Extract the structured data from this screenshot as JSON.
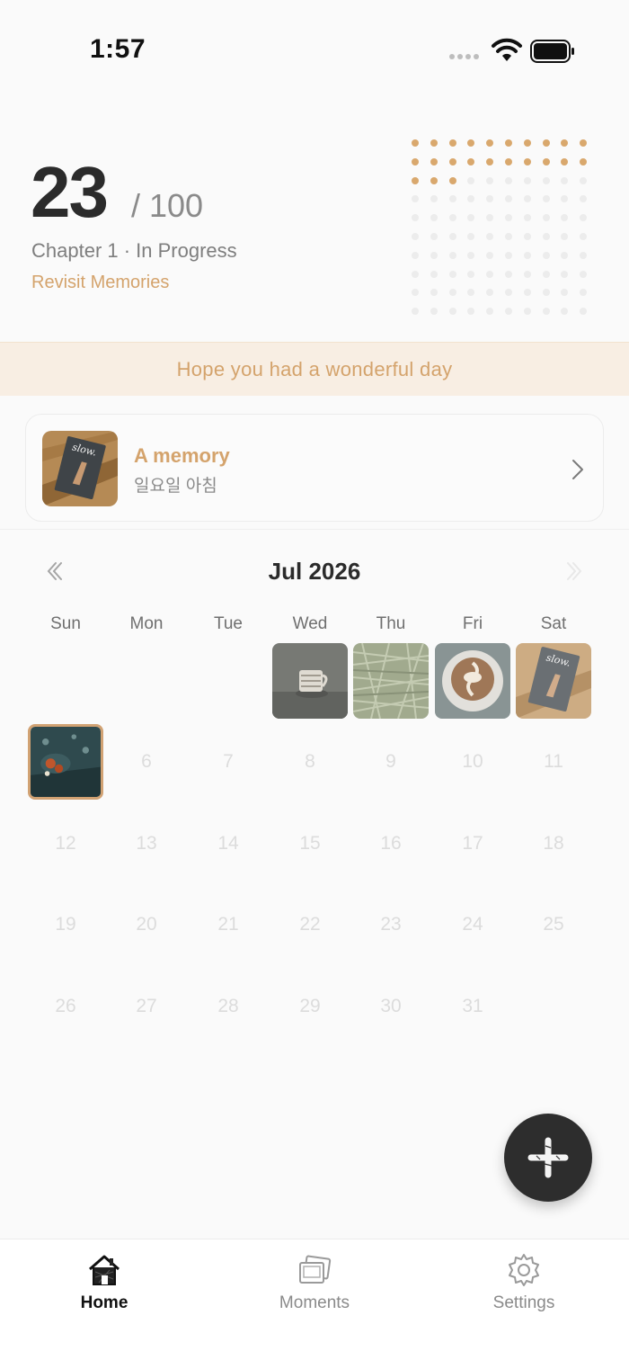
{
  "status_bar": {
    "time": "1:57"
  },
  "progress": {
    "count": "23",
    "total": "/ 100",
    "chapter_status": "Chapter 1 · In Progress",
    "revisit_label": "Revisit Memories",
    "filled_dots": 23,
    "total_dots": 100
  },
  "greeting": "Hope you had a wonderful day",
  "memory_card": {
    "title": "A memory",
    "subtitle": "일요일 아침"
  },
  "calendar": {
    "month_label": "Jul 2026",
    "weekdays": [
      "Sun",
      "Mon",
      "Tue",
      "Wed",
      "Thu",
      "Fri",
      "Sat"
    ],
    "days": [
      "6",
      "7",
      "8",
      "9",
      "10",
      "11",
      "12",
      "13",
      "14",
      "15",
      "16",
      "17",
      "18",
      "19",
      "20",
      "21",
      "22",
      "23",
      "24",
      "25",
      "26",
      "27",
      "28",
      "29",
      "30",
      "31"
    ],
    "photo_days": [
      {
        "day": "1",
        "weekday": "Wed",
        "photo": "coffee-cup-photo"
      },
      {
        "day": "2",
        "weekday": "Thu",
        "photo": "grass-photo"
      },
      {
        "day": "3",
        "weekday": "Fri",
        "photo": "latte-art-photo"
      },
      {
        "day": "4",
        "weekday": "Sat",
        "photo": "book-slow-photo"
      },
      {
        "day": "5",
        "weekday": "Sun",
        "photo": "breakfast-tray-photo",
        "today": true
      }
    ]
  },
  "fab": {
    "icon": "plus-icon"
  },
  "tab_bar": {
    "tabs": [
      {
        "label": "Home",
        "icon": "house-icon",
        "active": true
      },
      {
        "label": "Moments",
        "icon": "photos-icon",
        "active": false
      },
      {
        "label": "Settings",
        "icon": "gear-icon",
        "active": false
      }
    ]
  },
  "colors": {
    "accent": "#d4a36c",
    "banner_bg": "#f8eee3",
    "text_dark": "#2b2b2b",
    "fab_bg": "#2d2d2d",
    "dot_empty": "#ececec"
  }
}
